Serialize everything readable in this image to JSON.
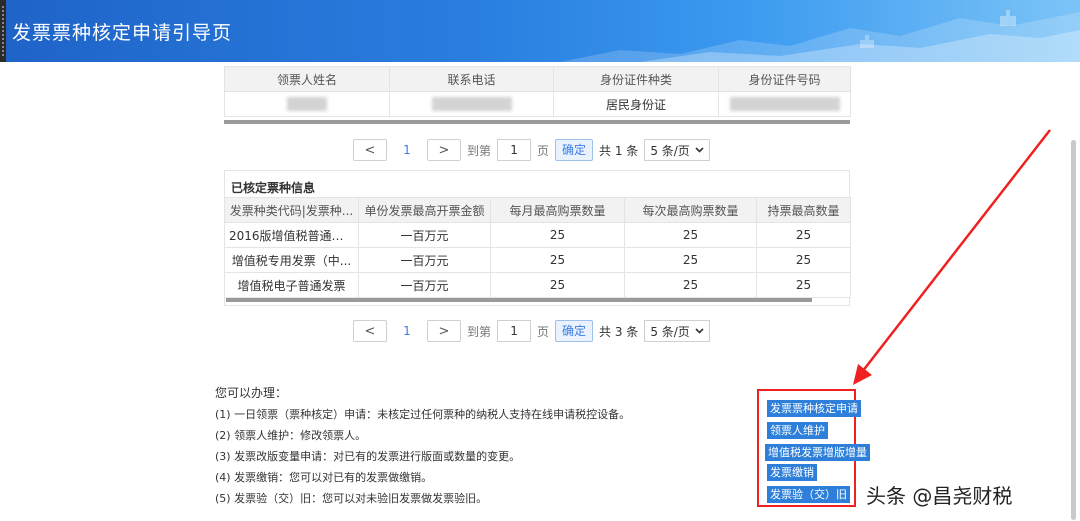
{
  "header": {
    "title": "发票票种核定申请引导页"
  },
  "ticket_holder": {
    "columns": [
      "领票人姓名",
      "联系电话",
      "身份证件种类",
      "身份证件号码"
    ],
    "row": {
      "id_type": "居民身份证"
    }
  },
  "pager1": {
    "prev": "<",
    "page": "1",
    "next": ">",
    "goto_label": "到第",
    "goto_value": "1",
    "page_unit": "页",
    "confirm": "确定",
    "total": "共 1 条",
    "page_size": "5 条/页"
  },
  "approved": {
    "caption": "已核定票种信息",
    "columns": [
      "发票种类代码|发票种...",
      "单份发票最高开票金额",
      "每月最高购票数量",
      "每次最高购票数量",
      "持票最高数量"
    ],
    "rows": [
      [
        "2016版增值税普通发...",
        "一百万元",
        "25",
        "25",
        "25"
      ],
      [
        "增值税专用发票（中...",
        "一百万元",
        "25",
        "25",
        "25"
      ],
      [
        "增值税电子普通发票",
        "一百万元",
        "25",
        "25",
        "25"
      ]
    ]
  },
  "pager2": {
    "prev": "<",
    "page": "1",
    "next": ">",
    "goto_label": "到第",
    "goto_value": "1",
    "page_unit": "页",
    "confirm": "确定",
    "total": "共 3 条",
    "page_size": "5 条/页"
  },
  "notes": {
    "heading": "您可以办理：",
    "lines": [
      "(1) 一日领票（票种核定）申请：未核定过任何票种的纳税人支持在线申请税控设备。",
      "(2) 领票人维护：修改领票人。",
      "(3) 发票改版变量申请：对已有的发票进行版面或数量的变更。",
      "(4) 发票缴销：您可以对已有的发票做缴销。",
      "(5) 发票验（交）旧：您可以对未验旧发票做发票验旧。"
    ]
  },
  "actions": {
    "b1": "发票票种核定申请",
    "b2": "领票人维护",
    "b3": "增值税发票增版增量",
    "b4": "发票缴销",
    "b5": "发票验（交）旧"
  },
  "watermark": "头条 @昌尧财税",
  "colors": {
    "header": "#2a7fe0",
    "button": "#2e7fd9",
    "highlight": "#f02020"
  }
}
